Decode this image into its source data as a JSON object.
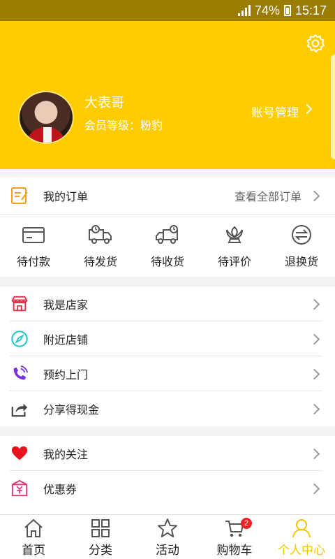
{
  "status_bar": {
    "battery": "74%",
    "time": "15:17"
  },
  "header": {
    "username": "大表哥",
    "member_level": "会员等级：粉豹",
    "account_link": "账号管理"
  },
  "orders": {
    "title": "我的订单",
    "view_all": "查看全部订单",
    "items": [
      {
        "label": "待付款",
        "icon": "wallet-card-icon"
      },
      {
        "label": "待发货",
        "icon": "truck-clock-icon"
      },
      {
        "label": "待收货",
        "icon": "truck-clock-icon"
      },
      {
        "label": "待评价",
        "icon": "flower-icon"
      },
      {
        "label": "退换货",
        "icon": "exchange-icon"
      }
    ]
  },
  "menu_group_1": [
    {
      "label": "我是店家",
      "icon": "store-icon",
      "color": "#e0304a"
    },
    {
      "label": "附近店铺",
      "icon": "compass-icon",
      "color": "#1fc9c9"
    },
    {
      "label": "预约上门",
      "icon": "phone-icon",
      "color": "#7a2fd8"
    },
    {
      "label": "分享得现金",
      "icon": "share-icon",
      "color": "#444444"
    }
  ],
  "menu_group_2": [
    {
      "label": "我的关注",
      "icon": "heart-icon",
      "color": "#e8131c"
    },
    {
      "label": "优惠券",
      "icon": "coupon-icon",
      "color": "#e0307a"
    }
  ],
  "tabbar": {
    "items": [
      {
        "label": "首页",
        "icon": "home-icon"
      },
      {
        "label": "分类",
        "icon": "grid-icon"
      },
      {
        "label": "活动",
        "icon": "star-icon"
      },
      {
        "label": "购物车",
        "icon": "cart-icon",
        "badge": "2"
      },
      {
        "label": "个人中心",
        "icon": "person-icon",
        "active": true
      }
    ]
  },
  "colors": {
    "accent": "#ffcc00",
    "active_tab": "#f5c400",
    "status_bar": "#9a7c00"
  }
}
